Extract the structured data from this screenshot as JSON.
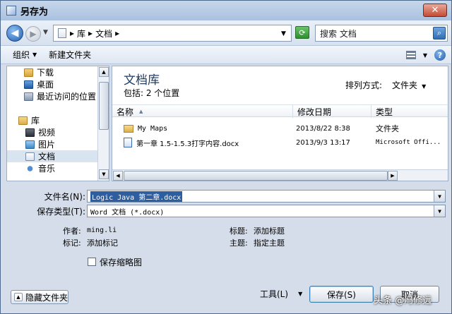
{
  "window": {
    "title": "另存为"
  },
  "nav": {
    "address_segments": [
      "库",
      "文档"
    ],
    "search_placeholder": "搜索 文档"
  },
  "toolbar": {
    "organize": "组织",
    "new_folder": "新建文件夹"
  },
  "sidebar": {
    "items": [
      {
        "label": "下载",
        "icon": "download-folder-icon"
      },
      {
        "label": "桌面",
        "icon": "desktop-icon"
      },
      {
        "label": "最近访问的位置",
        "icon": "recent-places-icon"
      },
      {
        "label": "库",
        "icon": "library-icon"
      },
      {
        "label": "视频",
        "icon": "video-icon"
      },
      {
        "label": "图片",
        "icon": "pictures-icon"
      },
      {
        "label": "文档",
        "icon": "documents-icon",
        "selected": true
      },
      {
        "label": "音乐",
        "icon": "music-icon"
      }
    ]
  },
  "content": {
    "library_title": "文档库",
    "library_subtitle": "包括: 2 个位置",
    "arrange_label": "排列方式:",
    "arrange_value": "文件夹",
    "columns": [
      "名称",
      "修改日期",
      "类型"
    ],
    "files": [
      {
        "name": "My Maps",
        "date": "2013/8/22 8:38",
        "type": "文件夹",
        "icon": "folder-icon"
      },
      {
        "name": "第一章 1.5-1.5.3打字内容.docx",
        "date": "2013/9/3 13:17",
        "type": "Microsoft Offi...",
        "icon": "word-doc-icon"
      }
    ]
  },
  "form": {
    "filename_label": "文件名(N):",
    "filename_value": "Logic Java 第二章.docx",
    "filetype_label": "保存类型(T):",
    "filetype_value": "Word 文档 (*.docx)",
    "author_label": "作者:",
    "author_value": "ming.li",
    "tags_label": "标记:",
    "tags_value": "添加标记",
    "title_label": "标题:",
    "title_value": "添加标题",
    "subject_label": "主题:",
    "subject_value": "指定主题",
    "thumbnail_label": "保存缩略图"
  },
  "footer": {
    "hide_folders": "隐藏文件夹",
    "tools": "工具(L)",
    "save": "保存(S)",
    "cancel": "取消"
  },
  "watermark": "头条 @冯修远"
}
